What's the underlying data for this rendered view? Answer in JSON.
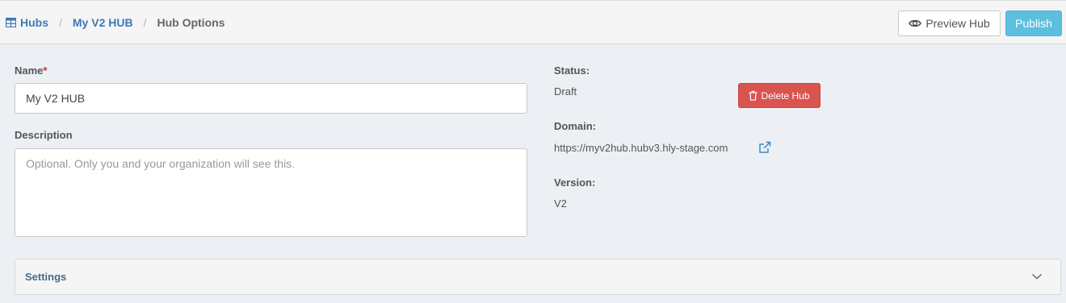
{
  "breadcrumb": {
    "hubs": "Hubs",
    "hub": "My V2 HUB",
    "current": "Hub Options",
    "separator": "/"
  },
  "toolbar": {
    "preview_label": "Preview Hub",
    "publish_label": "Publish"
  },
  "form": {
    "name_label": "Name",
    "name_required": "*",
    "name_value": "My V2 HUB",
    "description_label": "Description",
    "description_placeholder": "Optional. Only you and your organization will see this.",
    "description_value": ""
  },
  "info": {
    "status_label": "Status:",
    "status_value": "Draft",
    "delete_label": "Delete Hub",
    "domain_label": "Domain:",
    "domain_value": "https://myv2hub.hubv3.hly-stage.com",
    "version_label": "Version:",
    "version_value": "V2"
  },
  "settings": {
    "label": "Settings"
  },
  "colors": {
    "link": "#3a7ab6",
    "publish": "#5bc0de",
    "danger": "#d9534f",
    "background": "#eceff4"
  },
  "icons": [
    "table-icon",
    "eye-icon",
    "trash-icon",
    "external-link-icon",
    "chevron-down-icon"
  ]
}
